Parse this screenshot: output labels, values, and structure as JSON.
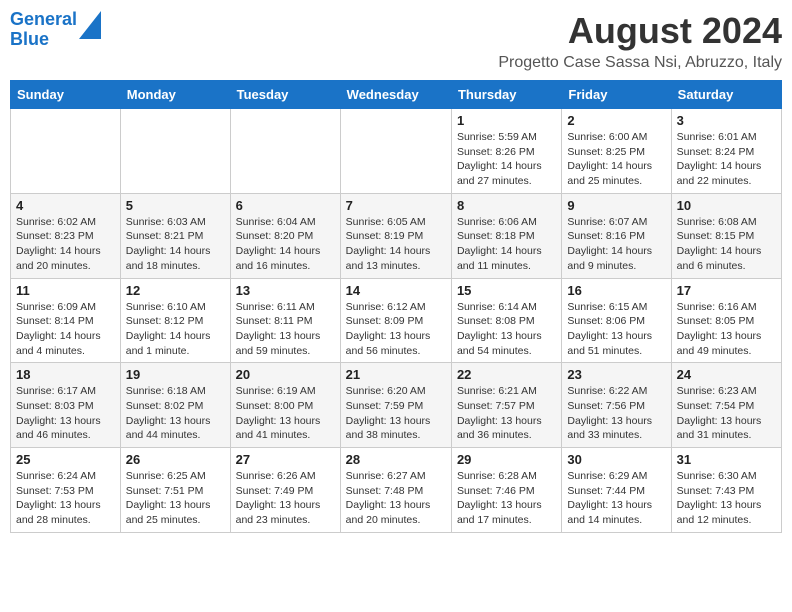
{
  "logo": {
    "line1": "General",
    "line2": "Blue"
  },
  "title": "August 2024",
  "subtitle": "Progetto Case Sassa Nsi, Abruzzo, Italy",
  "days_of_week": [
    "Sunday",
    "Monday",
    "Tuesday",
    "Wednesday",
    "Thursday",
    "Friday",
    "Saturday"
  ],
  "weeks": [
    [
      {
        "day": "",
        "info": ""
      },
      {
        "day": "",
        "info": ""
      },
      {
        "day": "",
        "info": ""
      },
      {
        "day": "",
        "info": ""
      },
      {
        "day": "1",
        "info": "Sunrise: 5:59 AM\nSunset: 8:26 PM\nDaylight: 14 hours and 27 minutes."
      },
      {
        "day": "2",
        "info": "Sunrise: 6:00 AM\nSunset: 8:25 PM\nDaylight: 14 hours and 25 minutes."
      },
      {
        "day": "3",
        "info": "Sunrise: 6:01 AM\nSunset: 8:24 PM\nDaylight: 14 hours and 22 minutes."
      }
    ],
    [
      {
        "day": "4",
        "info": "Sunrise: 6:02 AM\nSunset: 8:23 PM\nDaylight: 14 hours and 20 minutes."
      },
      {
        "day": "5",
        "info": "Sunrise: 6:03 AM\nSunset: 8:21 PM\nDaylight: 14 hours and 18 minutes."
      },
      {
        "day": "6",
        "info": "Sunrise: 6:04 AM\nSunset: 8:20 PM\nDaylight: 14 hours and 16 minutes."
      },
      {
        "day": "7",
        "info": "Sunrise: 6:05 AM\nSunset: 8:19 PM\nDaylight: 14 hours and 13 minutes."
      },
      {
        "day": "8",
        "info": "Sunrise: 6:06 AM\nSunset: 8:18 PM\nDaylight: 14 hours and 11 minutes."
      },
      {
        "day": "9",
        "info": "Sunrise: 6:07 AM\nSunset: 8:16 PM\nDaylight: 14 hours and 9 minutes."
      },
      {
        "day": "10",
        "info": "Sunrise: 6:08 AM\nSunset: 8:15 PM\nDaylight: 14 hours and 6 minutes."
      }
    ],
    [
      {
        "day": "11",
        "info": "Sunrise: 6:09 AM\nSunset: 8:14 PM\nDaylight: 14 hours and 4 minutes."
      },
      {
        "day": "12",
        "info": "Sunrise: 6:10 AM\nSunset: 8:12 PM\nDaylight: 14 hours and 1 minute."
      },
      {
        "day": "13",
        "info": "Sunrise: 6:11 AM\nSunset: 8:11 PM\nDaylight: 13 hours and 59 minutes."
      },
      {
        "day": "14",
        "info": "Sunrise: 6:12 AM\nSunset: 8:09 PM\nDaylight: 13 hours and 56 minutes."
      },
      {
        "day": "15",
        "info": "Sunrise: 6:14 AM\nSunset: 8:08 PM\nDaylight: 13 hours and 54 minutes."
      },
      {
        "day": "16",
        "info": "Sunrise: 6:15 AM\nSunset: 8:06 PM\nDaylight: 13 hours and 51 minutes."
      },
      {
        "day": "17",
        "info": "Sunrise: 6:16 AM\nSunset: 8:05 PM\nDaylight: 13 hours and 49 minutes."
      }
    ],
    [
      {
        "day": "18",
        "info": "Sunrise: 6:17 AM\nSunset: 8:03 PM\nDaylight: 13 hours and 46 minutes."
      },
      {
        "day": "19",
        "info": "Sunrise: 6:18 AM\nSunset: 8:02 PM\nDaylight: 13 hours and 44 minutes."
      },
      {
        "day": "20",
        "info": "Sunrise: 6:19 AM\nSunset: 8:00 PM\nDaylight: 13 hours and 41 minutes."
      },
      {
        "day": "21",
        "info": "Sunrise: 6:20 AM\nSunset: 7:59 PM\nDaylight: 13 hours and 38 minutes."
      },
      {
        "day": "22",
        "info": "Sunrise: 6:21 AM\nSunset: 7:57 PM\nDaylight: 13 hours and 36 minutes."
      },
      {
        "day": "23",
        "info": "Sunrise: 6:22 AM\nSunset: 7:56 PM\nDaylight: 13 hours and 33 minutes."
      },
      {
        "day": "24",
        "info": "Sunrise: 6:23 AM\nSunset: 7:54 PM\nDaylight: 13 hours and 31 minutes."
      }
    ],
    [
      {
        "day": "25",
        "info": "Sunrise: 6:24 AM\nSunset: 7:53 PM\nDaylight: 13 hours and 28 minutes."
      },
      {
        "day": "26",
        "info": "Sunrise: 6:25 AM\nSunset: 7:51 PM\nDaylight: 13 hours and 25 minutes."
      },
      {
        "day": "27",
        "info": "Sunrise: 6:26 AM\nSunset: 7:49 PM\nDaylight: 13 hours and 23 minutes."
      },
      {
        "day": "28",
        "info": "Sunrise: 6:27 AM\nSunset: 7:48 PM\nDaylight: 13 hours and 20 minutes."
      },
      {
        "day": "29",
        "info": "Sunrise: 6:28 AM\nSunset: 7:46 PM\nDaylight: 13 hours and 17 minutes."
      },
      {
        "day": "30",
        "info": "Sunrise: 6:29 AM\nSunset: 7:44 PM\nDaylight: 13 hours and 14 minutes."
      },
      {
        "day": "31",
        "info": "Sunrise: 6:30 AM\nSunset: 7:43 PM\nDaylight: 13 hours and 12 minutes."
      }
    ]
  ]
}
